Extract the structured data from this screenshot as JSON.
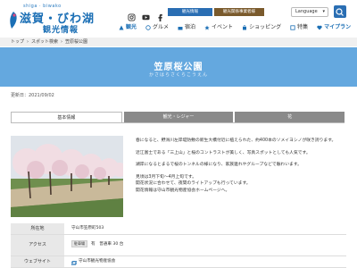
{
  "colors": {
    "brand_blue": "#1b6fb5",
    "hero_blue": "#64a8df",
    "corp_brown": "#7a5a2c",
    "tab_gray": "#8a8a8a"
  },
  "header": {
    "logo": {
      "small": "shiga · biwako",
      "main": "滋賀・びわ湖",
      "sub": "観光情報"
    },
    "sns": [
      "instagram-icon",
      "youtube-icon",
      "facebook-icon"
    ],
    "tabs": {
      "visit": "観光情報",
      "corp": "観光関係事業者様"
    },
    "language": "Language",
    "nav": [
      {
        "label": "観光",
        "icon": "sightseeing-icon"
      },
      {
        "label": "グルメ",
        "icon": "gourmet-icon"
      },
      {
        "label": "宿泊",
        "icon": "lodging-icon"
      },
      {
        "label": "イベント",
        "icon": "event-icon"
      },
      {
        "label": "ショッピング",
        "icon": "shopping-icon"
      },
      {
        "label": "特集",
        "icon": "feature-icon"
      },
      {
        "label": "マイプラン",
        "icon": "myplan-icon"
      }
    ]
  },
  "breadcrumb": [
    "トップ",
    "スポット検索",
    "笠原桜公園"
  ],
  "hero": {
    "title": "笠原桜公園",
    "kana": "かさはらさくらこうえん"
  },
  "updated": "更新日：2021/09/02",
  "tabs": [
    "基本情報",
    "観光・レジャー",
    "花"
  ],
  "description": [
    "春になると、野洲川左岸堤防敷の新生大橋付近に植えられた、約400本のソメイヨシノが咲き誇ります。",
    "近江富士である「三上山」と桜のコントラストが美しく、写真スポットとしても人気です。",
    "湖岸になるとまるで桜のトンネルの様になり、家族連れやグループなどで賑わいます。",
    "見頃は3月下旬～4月上旬です。",
    "開花状況に合わせて、夜間のライトアップも行っています。",
    "開花情報は守山市観光物産協会ホームページへ。"
  ],
  "info": {
    "address": {
      "label": "所在地",
      "value": "守山市笠原町503"
    },
    "access": {
      "label": "アクセス",
      "mode": "駐車場",
      "value": "有　普通車 30 台"
    },
    "website": {
      "label": "ウェブサイト",
      "value": "守山市観光物産協会"
    }
  }
}
